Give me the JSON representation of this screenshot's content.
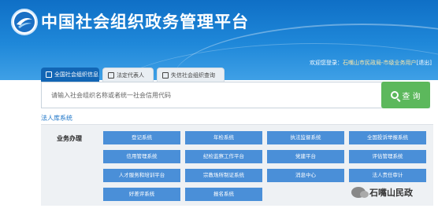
{
  "header": {
    "site_title": "中国社会组织政务管理平台",
    "welcome_prefix": "欢迎您登录：",
    "welcome_user": "石嘴山市民政局-市级业务用户",
    "welcome_suffix": "[退出]"
  },
  "tabs": [
    {
      "label": "全国社会组织信息",
      "active": true
    },
    {
      "label": "法定代表人",
      "active": false
    },
    {
      "label": "失信社会组织查询",
      "active": false
    }
  ],
  "search": {
    "placeholder": "请输入社会组织名称或者统一社会信用代码",
    "button_label": "查 询"
  },
  "section": {
    "title": "法人库系统"
  },
  "panel": {
    "label": "业务办理",
    "buttons": [
      "登记系统",
      "年检系统",
      "执法监督系统",
      "全国投诉举报系统",
      "信用管理系统",
      "纪检监察工作平台",
      "党建平台",
      "评估管理系统",
      "人才服务和培训平台",
      "宗教场所制证系统",
      "消息中心",
      "法人责任审计",
      "好差评系统",
      "报名系统"
    ]
  },
  "watermark": {
    "text": "石嘴山民政"
  },
  "colors": {
    "header_blue": "#1f88d9",
    "tab_active": "#1266b5",
    "search_button": "#5cb85c",
    "system_button": "#4a8fd8",
    "section_title": "#1a73c7"
  }
}
